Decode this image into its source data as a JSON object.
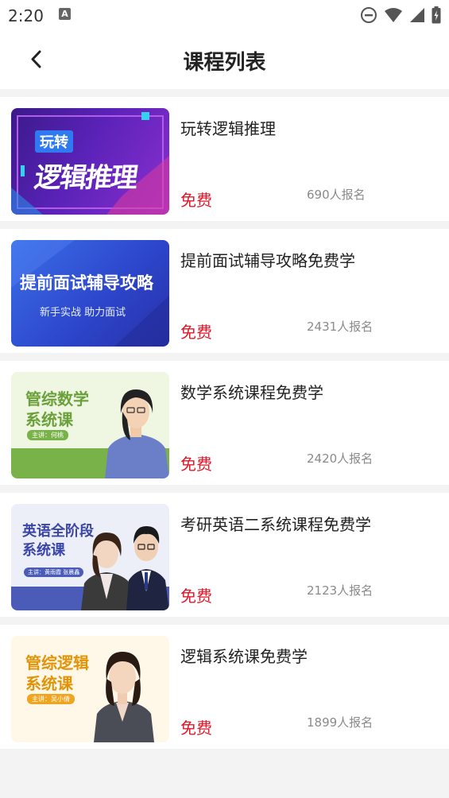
{
  "status_bar": {
    "time": "2:20",
    "a_icon": "A"
  },
  "header": {
    "title": "课程列表"
  },
  "courses": [
    {
      "title": "玩转逻辑推理",
      "price": "免费",
      "enrolled": "690人报名",
      "thumb": {
        "badge": "玩转",
        "main": "逻辑推理"
      }
    },
    {
      "title": "提前面试辅导攻略免费学",
      "price": "免费",
      "enrolled": "2431人报名",
      "thumb": {
        "main": "提前面试辅导攻略",
        "sub": "新手实战   助力面试"
      }
    },
    {
      "title": "数学系统课程免费学",
      "price": "免费",
      "enrolled": "2420人报名",
      "thumb": {
        "line1": "管综数学",
        "line2": "系统课",
        "tag": "主讲：何桃"
      }
    },
    {
      "title": "考研英语二系统课程免费学",
      "price": "免费",
      "enrolled": "2123人报名",
      "thumb": {
        "line1": "英语全阶段",
        "line2": "系统课",
        "tag": "主讲：黄雨霞 张晨鑫"
      }
    },
    {
      "title": "逻辑系统课免费学",
      "price": "免费",
      "enrolled": "1899人报名",
      "thumb": {
        "line1": "管综逻辑",
        "line2": "系统课",
        "tag": "主讲：吴小倩"
      }
    }
  ]
}
